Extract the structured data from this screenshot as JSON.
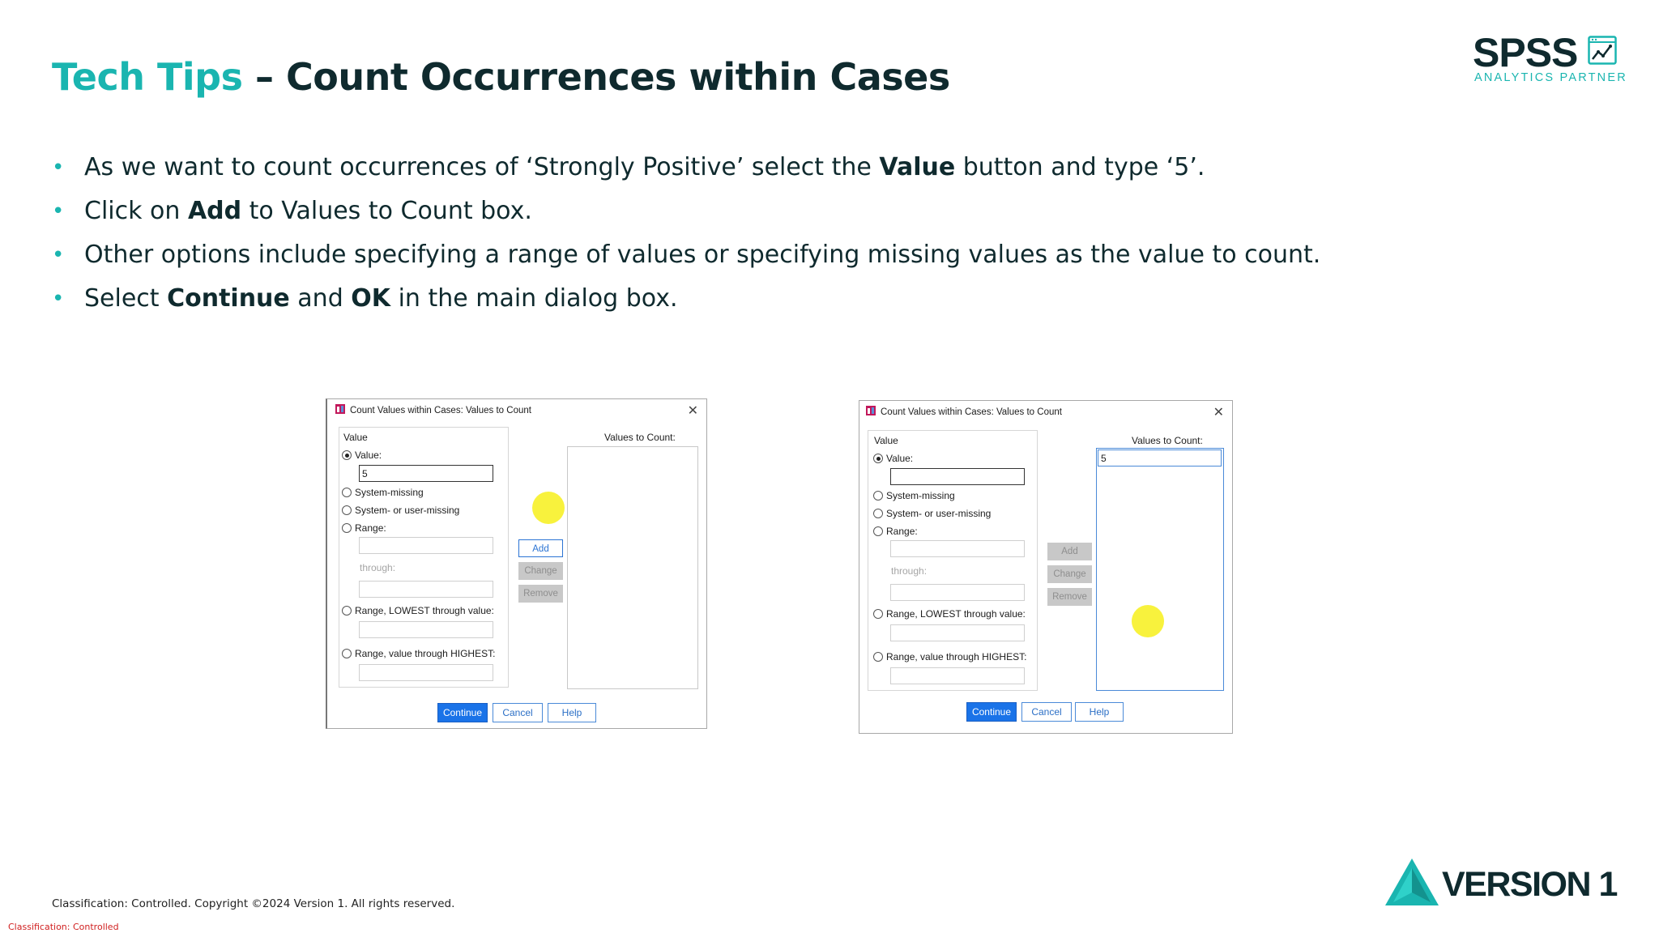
{
  "slide": {
    "title_accent": "Tech Tips",
    "title_rest": " – Count Occurrences within Cases",
    "logo": {
      "word": "SPSS",
      "subtitle": "ANALYTICS PARTNER",
      "icon": "line-chart-icon"
    },
    "bullets": [
      {
        "pre": "As we want to count occurrences of ‘Strongly Positive’ select the ",
        "bold": "Value",
        "post": " button and type ‘5’."
      },
      {
        "pre": "Click on ",
        "bold": "Add",
        "post": " to Values to Count box."
      },
      {
        "pre": "Other options include specifying a range of values or specifying missing values as the value to count.",
        "bold": "",
        "post": ""
      },
      {
        "pre": "Select ",
        "bold": "Continue",
        "post": " and ",
        "bold2": "OK",
        "post2": " in the main dialog box."
      }
    ],
    "footer": {
      "copyright": "Classification: Controlled. Copyright ©2024 Version 1. All rights reserved.",
      "classification": "Classification: Controlled",
      "brand": "VERSION 1"
    },
    "colors": {
      "accent": "#1ab5b0",
      "dark": "#0f2a2e",
      "button_blue": "#1a73e8",
      "classification_red": "#d01f1f"
    }
  },
  "dialogs": [
    {
      "title": "Count Values within Cases: Values to Count",
      "value_group_label": "Value",
      "radio_value": "Value:",
      "value_input": "5",
      "radio_system_missing": "System-missing",
      "radio_system_user_missing": "System- or user-missing",
      "radio_range": "Range:",
      "through": "through:",
      "radio_range_lowest": "Range, LOWEST through value:",
      "radio_range_highest": "Range, value through HIGHEST:",
      "add": "Add",
      "change": "Change",
      "remove": "Remove",
      "values_to_count_label": "Values to Count:",
      "values_list": [],
      "continue": "Continue",
      "cancel": "Cancel",
      "help": "Help"
    },
    {
      "title": "Count Values within Cases: Values to Count",
      "value_group_label": "Value",
      "radio_value": "Value:",
      "value_input": "",
      "radio_system_missing": "System-missing",
      "radio_system_user_missing": "System- or user-missing",
      "radio_range": "Range:",
      "through": "through:",
      "radio_range_lowest": "Range, LOWEST through value:",
      "radio_range_highest": "Range, value through HIGHEST:",
      "add": "Add",
      "change": "Change",
      "remove": "Remove",
      "values_to_count_label": "Values to Count:",
      "values_list": [
        "5"
      ],
      "continue": "Continue",
      "cancel": "Cancel",
      "help": "Help"
    }
  ]
}
